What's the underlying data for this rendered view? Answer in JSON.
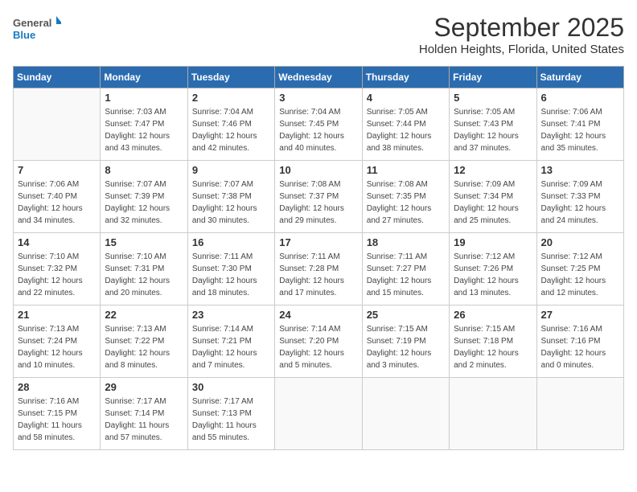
{
  "logo": {
    "text_general": "General",
    "text_blue": "Blue"
  },
  "header": {
    "month_year": "September 2025",
    "location": "Holden Heights, Florida, United States"
  },
  "days_of_week": [
    "Sunday",
    "Monday",
    "Tuesday",
    "Wednesday",
    "Thursday",
    "Friday",
    "Saturday"
  ],
  "weeks": [
    [
      {
        "day": "",
        "info": ""
      },
      {
        "day": "1",
        "info": "Sunrise: 7:03 AM\nSunset: 7:47 PM\nDaylight: 12 hours\nand 43 minutes."
      },
      {
        "day": "2",
        "info": "Sunrise: 7:04 AM\nSunset: 7:46 PM\nDaylight: 12 hours\nand 42 minutes."
      },
      {
        "day": "3",
        "info": "Sunrise: 7:04 AM\nSunset: 7:45 PM\nDaylight: 12 hours\nand 40 minutes."
      },
      {
        "day": "4",
        "info": "Sunrise: 7:05 AM\nSunset: 7:44 PM\nDaylight: 12 hours\nand 38 minutes."
      },
      {
        "day": "5",
        "info": "Sunrise: 7:05 AM\nSunset: 7:43 PM\nDaylight: 12 hours\nand 37 minutes."
      },
      {
        "day": "6",
        "info": "Sunrise: 7:06 AM\nSunset: 7:41 PM\nDaylight: 12 hours\nand 35 minutes."
      }
    ],
    [
      {
        "day": "7",
        "info": "Sunrise: 7:06 AM\nSunset: 7:40 PM\nDaylight: 12 hours\nand 34 minutes."
      },
      {
        "day": "8",
        "info": "Sunrise: 7:07 AM\nSunset: 7:39 PM\nDaylight: 12 hours\nand 32 minutes."
      },
      {
        "day": "9",
        "info": "Sunrise: 7:07 AM\nSunset: 7:38 PM\nDaylight: 12 hours\nand 30 minutes."
      },
      {
        "day": "10",
        "info": "Sunrise: 7:08 AM\nSunset: 7:37 PM\nDaylight: 12 hours\nand 29 minutes."
      },
      {
        "day": "11",
        "info": "Sunrise: 7:08 AM\nSunset: 7:35 PM\nDaylight: 12 hours\nand 27 minutes."
      },
      {
        "day": "12",
        "info": "Sunrise: 7:09 AM\nSunset: 7:34 PM\nDaylight: 12 hours\nand 25 minutes."
      },
      {
        "day": "13",
        "info": "Sunrise: 7:09 AM\nSunset: 7:33 PM\nDaylight: 12 hours\nand 24 minutes."
      }
    ],
    [
      {
        "day": "14",
        "info": "Sunrise: 7:10 AM\nSunset: 7:32 PM\nDaylight: 12 hours\nand 22 minutes."
      },
      {
        "day": "15",
        "info": "Sunrise: 7:10 AM\nSunset: 7:31 PM\nDaylight: 12 hours\nand 20 minutes."
      },
      {
        "day": "16",
        "info": "Sunrise: 7:11 AM\nSunset: 7:30 PM\nDaylight: 12 hours\nand 18 minutes."
      },
      {
        "day": "17",
        "info": "Sunrise: 7:11 AM\nSunset: 7:28 PM\nDaylight: 12 hours\nand 17 minutes."
      },
      {
        "day": "18",
        "info": "Sunrise: 7:11 AM\nSunset: 7:27 PM\nDaylight: 12 hours\nand 15 minutes."
      },
      {
        "day": "19",
        "info": "Sunrise: 7:12 AM\nSunset: 7:26 PM\nDaylight: 12 hours\nand 13 minutes."
      },
      {
        "day": "20",
        "info": "Sunrise: 7:12 AM\nSunset: 7:25 PM\nDaylight: 12 hours\nand 12 minutes."
      }
    ],
    [
      {
        "day": "21",
        "info": "Sunrise: 7:13 AM\nSunset: 7:24 PM\nDaylight: 12 hours\nand 10 minutes."
      },
      {
        "day": "22",
        "info": "Sunrise: 7:13 AM\nSunset: 7:22 PM\nDaylight: 12 hours\nand 8 minutes."
      },
      {
        "day": "23",
        "info": "Sunrise: 7:14 AM\nSunset: 7:21 PM\nDaylight: 12 hours\nand 7 minutes."
      },
      {
        "day": "24",
        "info": "Sunrise: 7:14 AM\nSunset: 7:20 PM\nDaylight: 12 hours\nand 5 minutes."
      },
      {
        "day": "25",
        "info": "Sunrise: 7:15 AM\nSunset: 7:19 PM\nDaylight: 12 hours\nand 3 minutes."
      },
      {
        "day": "26",
        "info": "Sunrise: 7:15 AM\nSunset: 7:18 PM\nDaylight: 12 hours\nand 2 minutes."
      },
      {
        "day": "27",
        "info": "Sunrise: 7:16 AM\nSunset: 7:16 PM\nDaylight: 12 hours\nand 0 minutes."
      }
    ],
    [
      {
        "day": "28",
        "info": "Sunrise: 7:16 AM\nSunset: 7:15 PM\nDaylight: 11 hours\nand 58 minutes."
      },
      {
        "day": "29",
        "info": "Sunrise: 7:17 AM\nSunset: 7:14 PM\nDaylight: 11 hours\nand 57 minutes."
      },
      {
        "day": "30",
        "info": "Sunrise: 7:17 AM\nSunset: 7:13 PM\nDaylight: 11 hours\nand 55 minutes."
      },
      {
        "day": "",
        "info": ""
      },
      {
        "day": "",
        "info": ""
      },
      {
        "day": "",
        "info": ""
      },
      {
        "day": "",
        "info": ""
      }
    ]
  ]
}
